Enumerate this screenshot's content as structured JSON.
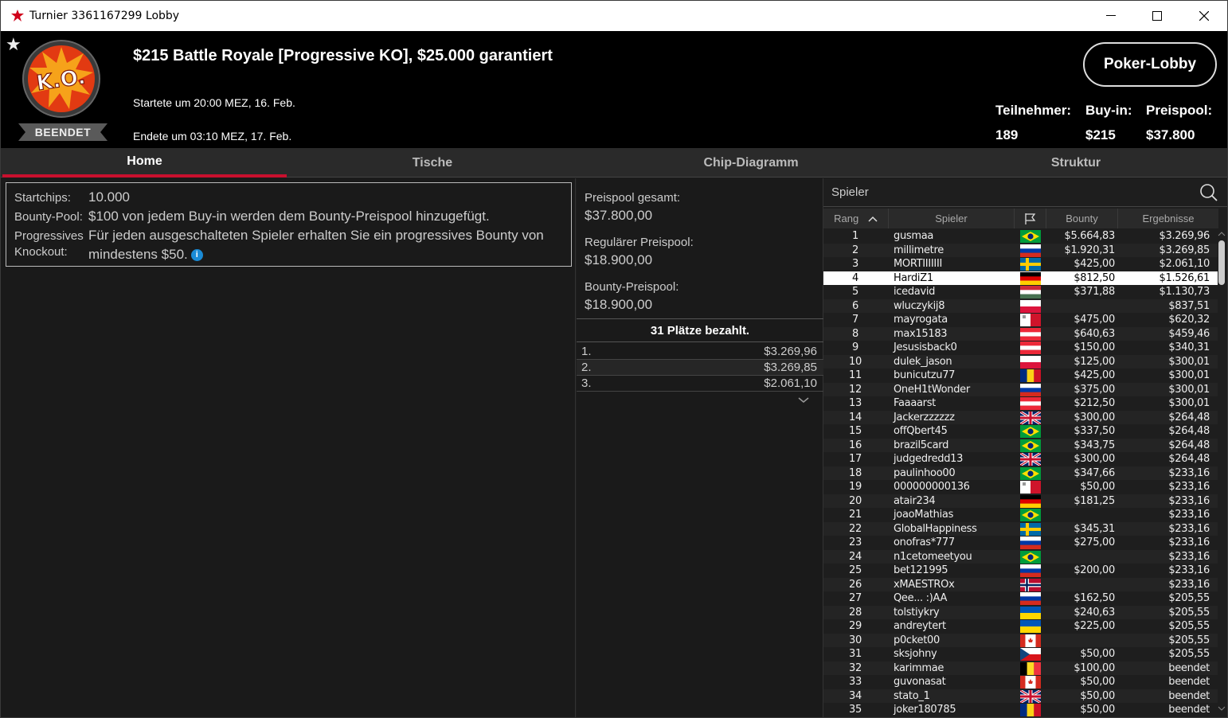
{
  "window": {
    "title": "Turnier 3361167299 Lobby"
  },
  "header": {
    "title": "$215 Battle Royale [Progressive KO], $25.000 garantiert",
    "started": "Startete um 20:00 MEZ, 16. Feb.",
    "ended": "Endete um 03:10 MEZ, 17. Feb.",
    "status": "BEENDET",
    "badge_text": "K.O.",
    "lobby_button": "Poker-Lobby",
    "stats": {
      "entrants_label": "Teilnehmer:",
      "entrants": "189",
      "buyin_label": "Buy-in:",
      "buyin": "$215",
      "prizepool_label": "Preispool:",
      "prizepool": "$37.800"
    }
  },
  "tabs": [
    "Home",
    "Tische",
    "Chip-Diagramm",
    "Struktur"
  ],
  "home": {
    "startchips_label": "Startchips:",
    "startchips": "10.000",
    "bounty_label": "Bounty-Pool:",
    "bounty": "$100 von jedem Buy-in werden dem Bounty-Preispool hinzugefügt.",
    "pko_label1": "Progressives",
    "pko_label2": "Knockout:",
    "pko_line1": "Für jeden ausgeschalteten Spieler erhalten Sie ein progressives Bounty von",
    "pko_line2": "mindestens $50."
  },
  "prizes": {
    "total_label": "Preispool gesamt:",
    "total": "$37.800,00",
    "regular_label": "Regulärer Preispool:",
    "regular": "$18.900,00",
    "bounty_label": "Bounty-Preispool:",
    "bounty": "$18.900,00",
    "paid": "31 Plätze bezahlt.",
    "places": [
      {
        "place": "1.",
        "amount": "$3.269,96"
      },
      {
        "place": "2.",
        "amount": "$3.269,85"
      },
      {
        "place": "3.",
        "amount": "$2.061,10"
      }
    ]
  },
  "players": {
    "search_label": "Spieler",
    "columns": [
      "Rang",
      "Spieler",
      "Bounty",
      "Ergebnisse"
    ],
    "rows": [
      [
        "1",
        "gusmaa",
        "br",
        "$5.664,83",
        "$3.269,96"
      ],
      [
        "2",
        "millimetre",
        "ru",
        "$1.920,31",
        "$3.269,85"
      ],
      [
        "3",
        "MORTIIIIIII",
        "se",
        "$425,00",
        "$2.061,10"
      ],
      [
        "4",
        "HardiZ1",
        "de",
        "$812,50",
        "$1.526,61"
      ],
      [
        "5",
        "icedavid",
        "hu",
        "$371,88",
        "$1.130,73"
      ],
      [
        "6",
        "wluczykij8",
        "pl",
        "",
        "$837,51"
      ],
      [
        "7",
        "mayrogata",
        "mt",
        "$475,00",
        "$620,32"
      ],
      [
        "8",
        "max15183",
        "at",
        "$640,63",
        "$459,46"
      ],
      [
        "9",
        "Jesusisback0",
        "at",
        "$150,00",
        "$340,31"
      ],
      [
        "10",
        "dulek_jason",
        "pl",
        "$125,00",
        "$300,01"
      ],
      [
        "11",
        "bunicutzu77",
        "ro",
        "$425,00",
        "$300,01"
      ],
      [
        "12",
        "OneH1tWonder",
        "ru",
        "$375,00",
        "$300,01"
      ],
      [
        "13",
        "Faaaarst",
        "at",
        "$212,50",
        "$300,01"
      ],
      [
        "14",
        "Jackerzzzzzz",
        "gb",
        "$300,00",
        "$264,48"
      ],
      [
        "15",
        "offQbert45",
        "br",
        "$337,50",
        "$264,48"
      ],
      [
        "16",
        "brazil5card",
        "br",
        "$343,75",
        "$264,48"
      ],
      [
        "17",
        "judgedredd13",
        "gb",
        "$300,00",
        "$264,48"
      ],
      [
        "18",
        "paulinhoo00",
        "br",
        "$347,66",
        "$233,16"
      ],
      [
        "19",
        "000000000136",
        "mt",
        "$50,00",
        "$233,16"
      ],
      [
        "20",
        "atair234",
        "de",
        "$181,25",
        "$233,16"
      ],
      [
        "21",
        "joaoMathias",
        "br",
        "",
        "$233,16"
      ],
      [
        "22",
        "GlobalHappiness",
        "se",
        "$345,31",
        "$233,16"
      ],
      [
        "23",
        "onofras*777",
        "ru",
        "$275,00",
        "$233,16"
      ],
      [
        "24",
        "n1cetomeetyou",
        "br",
        "",
        "$233,16"
      ],
      [
        "25",
        "bet121995",
        "ru",
        "$200,00",
        "$233,16"
      ],
      [
        "26",
        "xMAESTROx",
        "no",
        "",
        "$233,16"
      ],
      [
        "27",
        "Qee... :)AA",
        "ru",
        "$162,50",
        "$205,55"
      ],
      [
        "28",
        "tolstiykry",
        "ua",
        "$240,63",
        "$205,55"
      ],
      [
        "29",
        "andreytert",
        "ua",
        "$225,00",
        "$205,55"
      ],
      [
        "30",
        "p0cket00",
        "ca",
        "",
        "$205,55"
      ],
      [
        "31",
        "sksjohny",
        "cz",
        "$50,00",
        "$205,55"
      ],
      [
        "32",
        "karimmae",
        "be",
        "$100,00",
        "beendet"
      ],
      [
        "33",
        "guvonasat",
        "ca",
        "$50,00",
        "beendet"
      ],
      [
        "34",
        "stato_1",
        "gb",
        "$50,00",
        "beendet"
      ],
      [
        "35",
        "joker180785",
        "ro",
        "$50,00",
        "beendet"
      ]
    ],
    "selected_row": 4
  }
}
